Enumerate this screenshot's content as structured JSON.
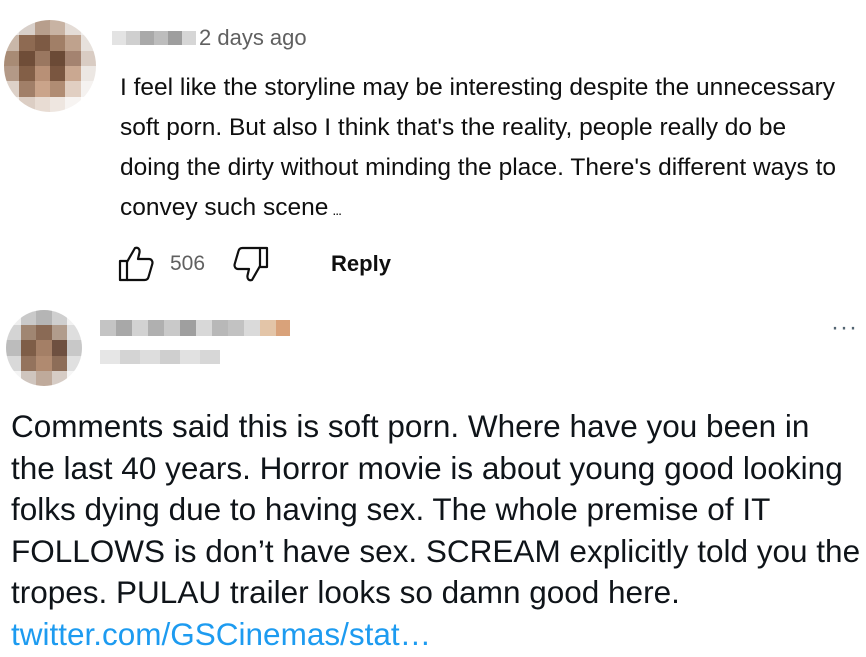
{
  "youtube_comment": {
    "timestamp": "2 days ago",
    "text": "I feel like the storyline may be interesting despite the unnecessary soft porn. But also I think that's the reality, people really do be doing the dirty without minding the place. There's different ways to convey such scene",
    "truncation": "...",
    "like_count": "506",
    "reply_label": "Reply",
    "icons": [
      "thumbs-up-icon",
      "thumbs-down-icon"
    ]
  },
  "tweet": {
    "text": "Comments said this is soft porn. Where have you been in the last 40 years. Horror movie is about young good looking folks dying due to having sex. The whole premise of IT FOLLOWS is don’t have sex. SCREAM explicitly told you the tropes. PULAU trailer looks so damn good here. ",
    "link_text": "twitter.com/GSCinemas/stat…",
    "more_label": "···",
    "link_color": "#1d9bf0"
  }
}
